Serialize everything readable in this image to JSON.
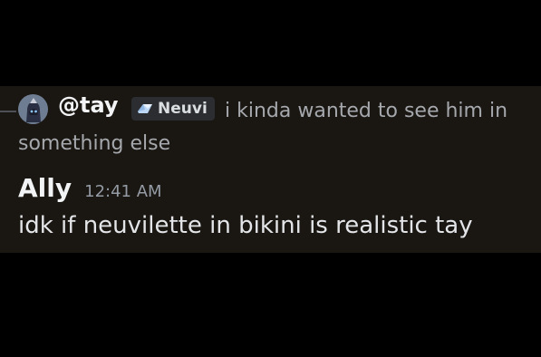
{
  "reply": {
    "author": "@tay",
    "role": "Neuvi",
    "role_icon": "gem-icon",
    "text": "i kinda wanted to see him in something else"
  },
  "message": {
    "author": "Ally",
    "timestamp": "12:41 AM",
    "text": "idk if neuvilette in bikini is realistic tay"
  },
  "colors": {
    "background": "#000000",
    "message_bg": "#1a1611",
    "author": "#f2f3f5",
    "reply_text": "#a5a8ad",
    "timestamp": "#949ba4",
    "role_tag_bg": "#2b2d31"
  }
}
